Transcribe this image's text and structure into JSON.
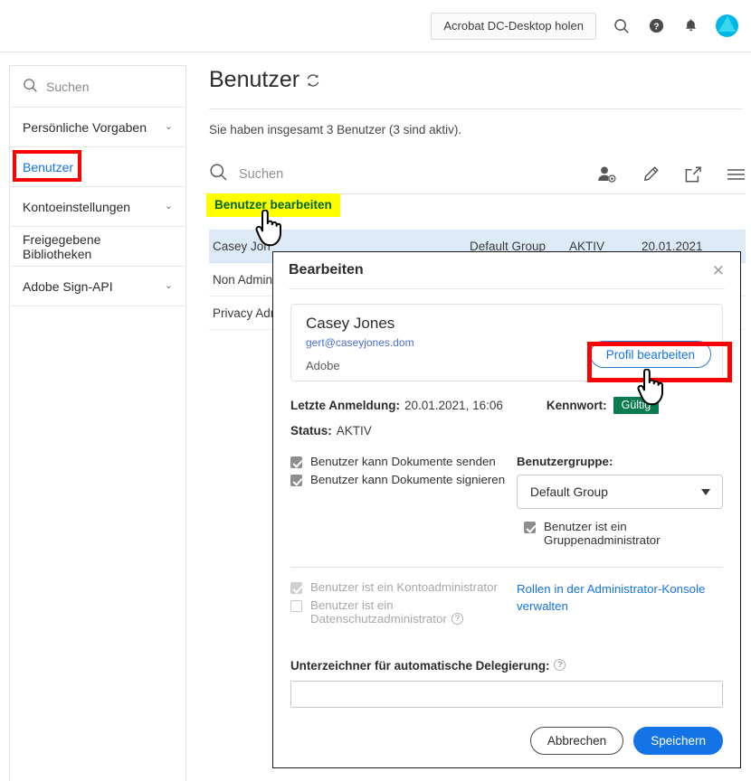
{
  "topbar": {
    "acrobat_button": "Acrobat DC-Desktop holen",
    "icons": [
      "search-icon",
      "help-icon",
      "bell-icon"
    ],
    "avatar": "user-avatar"
  },
  "sidebar": {
    "search_placeholder": "Suchen",
    "items": [
      {
        "label": "Persönliche Vorgaben",
        "expandable": true
      },
      {
        "label": "Benutzer",
        "expandable": false,
        "active": true
      },
      {
        "label": "Kontoeinstellungen",
        "expandable": true
      },
      {
        "label": "Freigegebene Bibliotheken",
        "expandable": false
      },
      {
        "label": "Adobe Sign-API",
        "expandable": true
      }
    ],
    "chevron": "⌄"
  },
  "main": {
    "title": "Benutzer",
    "count_text": "Sie haben insgesamt 3 Benutzer (3 sind aktiv).",
    "search_placeholder": "Suchen",
    "toolbar_icons": [
      "add-user-icon",
      "edit-pencil-icon",
      "export-icon",
      "menu-icon"
    ],
    "tooltip": "Benutzer bearbeiten",
    "rows": [
      {
        "name": "Casey Jon",
        "group": "Default Group",
        "status": "AKTIV",
        "date": "20.01.2021",
        "selected": true
      },
      {
        "name": "Non Admin",
        "group": "",
        "status": "",
        "date": "",
        "selected": false
      },
      {
        "name": "Privacy Adm",
        "group": "",
        "status": "",
        "date": "",
        "selected": false
      }
    ]
  },
  "dialog": {
    "title": "Bearbeiten",
    "close": "✕",
    "user": {
      "name": "Casey Jones",
      "email": "gert@caseyjones.dom",
      "org": "Adobe",
      "profile_button": "Profil bearbeiten"
    },
    "last_login_label": "Letzte Anmeldung:",
    "last_login_value": "20.01.2021, 16:06",
    "password_label": "Kennwort:",
    "password_badge": "Gültig",
    "status_label": "Status:",
    "status_value": "AKTIV",
    "permissions": [
      {
        "label": "Benutzer kann Dokumente senden",
        "checked": true,
        "disabled": false
      },
      {
        "label": "Benutzer kann Dokumente signieren",
        "checked": true,
        "disabled": false
      }
    ],
    "group_label": "Benutzergruppe:",
    "group_value": "Default Group",
    "group_admin": {
      "label": "Benutzer ist ein Gruppenadministrator",
      "checked": true,
      "disabled": false
    },
    "account_admin": {
      "label": "Benutzer ist ein Kontoadministrator",
      "checked": true,
      "disabled": true
    },
    "privacy_admin": {
      "label": "Benutzer ist ein Datenschutzadministrator",
      "checked": false,
      "disabled": true
    },
    "roles_link": "Rollen in der Administrator-Konsole verwalten",
    "delegation_label": "Unterzeichner für automatische Delegierung:",
    "delegation_value": "",
    "cancel_button": "Abbrechen",
    "save_button": "Speichern",
    "help_icon": "?"
  },
  "annotations": {
    "highlight_color": "#ffff00",
    "box_color": "#ff0000",
    "accent_blue": "#1473e6",
    "badge_green": "#0a7a4f"
  }
}
